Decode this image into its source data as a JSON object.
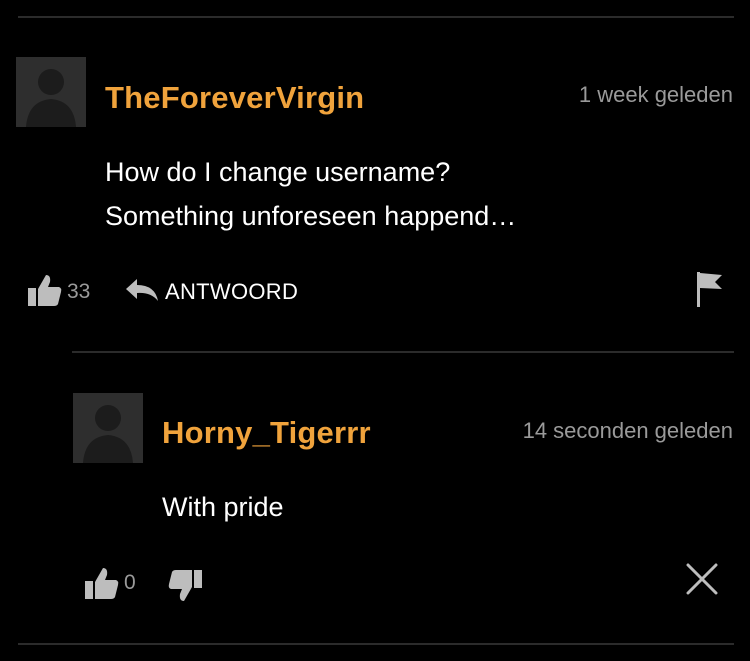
{
  "comments": [
    {
      "username": "TheForeverVirgin",
      "timestamp": "1 week geleden",
      "lines": [
        "How do I change username?",
        "Something unforeseen happend…"
      ],
      "likes": "33",
      "reply_label": "ANTWOORD"
    },
    {
      "username": "Horny_Tigerrr",
      "timestamp": "14 seconden geleden",
      "lines": [
        "With pride"
      ],
      "likes": "0"
    }
  ],
  "colors": {
    "background": "#000000",
    "username": "#f0a33c",
    "text": "#ffffff",
    "muted": "#9a9a9a",
    "avatar": "#2e2e2e",
    "icon": "#bdbdbd"
  },
  "icons": [
    "thumbs-up-icon",
    "reply-arrow-icon",
    "flag-icon",
    "thumbs-down-icon",
    "close-icon",
    "avatar-silhouette"
  ]
}
